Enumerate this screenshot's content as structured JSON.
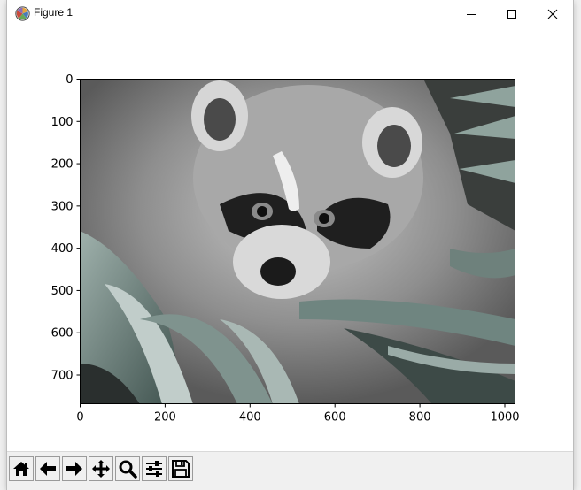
{
  "window": {
    "title": "Figure 1",
    "icons": {
      "app": "matplotlib-icon",
      "minimize": "minimize-icon",
      "maximize": "maximize-icon",
      "close": "close-icon"
    }
  },
  "figure": {
    "x_ticks": [
      "0",
      "200",
      "400",
      "600",
      "800",
      "1000"
    ],
    "y_ticks": [
      "0",
      "100",
      "200",
      "300",
      "400",
      "500",
      "600",
      "700"
    ],
    "xlim": [
      0,
      1024
    ],
    "ylim": [
      768,
      0
    ],
    "image_subject": "grayscale raccoon among palm leaves",
    "colors": {
      "leaf_tint": "#5f7a74",
      "frame": "#000000"
    }
  },
  "toolbar": {
    "buttons": [
      {
        "name": "home-button",
        "icon": "home-icon"
      },
      {
        "name": "back-button",
        "icon": "arrow-left-icon"
      },
      {
        "name": "forward-button",
        "icon": "arrow-right-icon"
      },
      {
        "name": "pan-button",
        "icon": "move-icon"
      },
      {
        "name": "zoom-button",
        "icon": "magnifier-icon"
      },
      {
        "name": "configure-subplots-button",
        "icon": "sliders-icon"
      },
      {
        "name": "save-button",
        "icon": "floppy-disk-icon"
      }
    ]
  }
}
